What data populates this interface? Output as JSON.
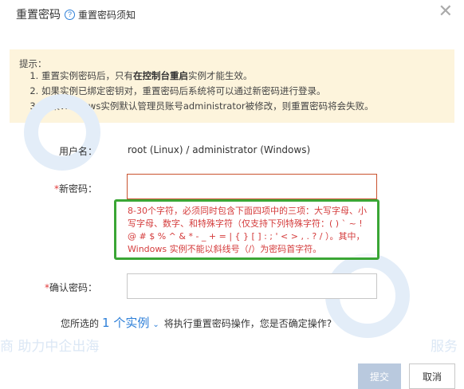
{
  "dialog": {
    "title": "重置密码",
    "help_link": "重置密码须知",
    "close_icon": "close-icon",
    "help_icon": "?"
  },
  "tips": {
    "title": "提示：",
    "items": [
      {
        "pre": "重置实例密码后，只有",
        "bold": "在控制台重启",
        "post": "实例才能生效。"
      },
      {
        "pre": "如果实例已绑定密钥对，重置密码后系统将可以通过新密码进行登录。",
        "bold": "",
        "post": ""
      },
      {
        "pre": "如果Windows实例默认管理员账号administrator被修改，则重置密码将会失败。",
        "bold": "",
        "post": ""
      }
    ]
  },
  "form": {
    "username_label": "用户名：",
    "username_value": "root (Linux) / administrator (Windows)",
    "new_password_label": "新密码：",
    "new_password_value": "",
    "required_mark": "*",
    "hint": "8-30个字符，必须同时包含下面四项中的三项：大写字母、小写字母、数字、和特殊字符（仅支持下列特殊字符：( ) ` ~ ! @ # $ % ^ & * - _ + = | { } [ ] : ; ' < > , . ? / ）。其中，Windows 实例不能以斜线号（/）为密码首字符。",
    "confirm_password_label": "确认密码：",
    "confirm_password_value": ""
  },
  "confirm": {
    "pre": "您所选的",
    "instance_count": "1 个实例",
    "post": "将执行重置密码操作，您是否确定操作?"
  },
  "buttons": {
    "submit": "提交",
    "cancel": "取消"
  },
  "watermark": {
    "text_1": "服务跨境电商  助力中企出海",
    "text_2": "商  助力中企出海",
    "text_3": "服务"
  },
  "colors": {
    "accent": "#2d7fd8",
    "tips_bg": "#fdf4dc",
    "error": "#d43b3b",
    "hint_border": "#3aa635"
  }
}
